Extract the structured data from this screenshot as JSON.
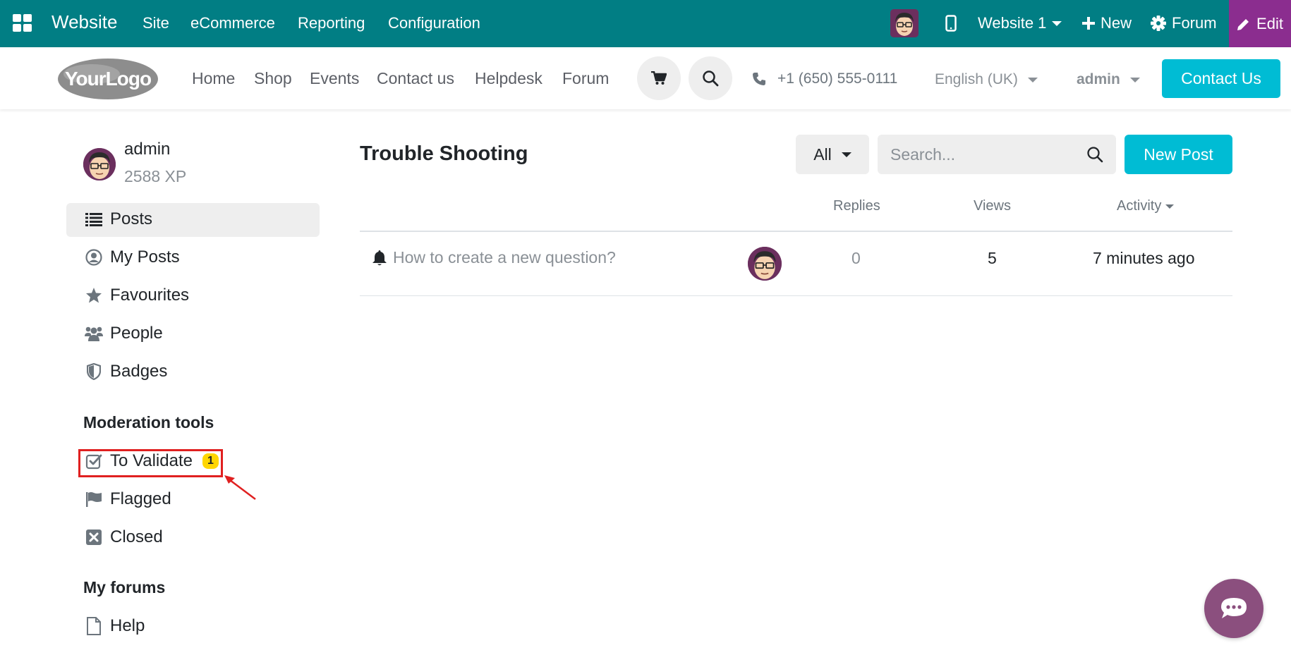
{
  "admin_bar": {
    "app_name": "Website",
    "menus": [
      "Site",
      "eCommerce",
      "Reporting",
      "Configuration"
    ],
    "website_selector": "Website 1",
    "new_label": "New",
    "forum_label": "Forum",
    "edit_label": "Edit"
  },
  "header": {
    "logo_text": "YourLogo",
    "nav": [
      "Home",
      "Shop",
      "Events",
      "Contact us",
      "Helpdesk",
      "Forum"
    ],
    "phone": "+1 (650) 555-0111",
    "language": "English (UK)",
    "user": "admin",
    "contact_button": "Contact Us"
  },
  "sidebar": {
    "user_name": "admin",
    "user_xp": "2588 XP",
    "items": [
      {
        "label": "Posts",
        "icon": "list-icon",
        "active": true
      },
      {
        "label": "My Posts",
        "icon": "user-circle-icon"
      },
      {
        "label": "Favourites",
        "icon": "star-icon"
      },
      {
        "label": "People",
        "icon": "users-icon"
      },
      {
        "label": "Badges",
        "icon": "shield-icon"
      }
    ],
    "moderation_heading": "Moderation tools",
    "moderation_items": [
      {
        "label": "To Validate",
        "icon": "check-square-icon",
        "badge": "1"
      },
      {
        "label": "Flagged",
        "icon": "flag-icon"
      },
      {
        "label": "Closed",
        "icon": "close-square-icon"
      }
    ],
    "my_forums_heading": "My forums",
    "forums": [
      {
        "label": "Help",
        "icon": "file-icon"
      }
    ]
  },
  "main": {
    "title": "Trouble Shooting",
    "filter_label": "All",
    "search_placeholder": "Search...",
    "new_post_label": "New Post",
    "columns": {
      "replies": "Replies",
      "views": "Views",
      "activity": "Activity"
    },
    "posts": [
      {
        "title": "How to create a new question?",
        "replies": "0",
        "views": "5",
        "activity": "7 minutes ago"
      }
    ]
  },
  "colors": {
    "admin_bar": "#017e84",
    "edit_button": "#8b2d8f",
    "primary_button": "#00bcd4",
    "badge": "#ffd600",
    "highlight": "#e02020"
  }
}
